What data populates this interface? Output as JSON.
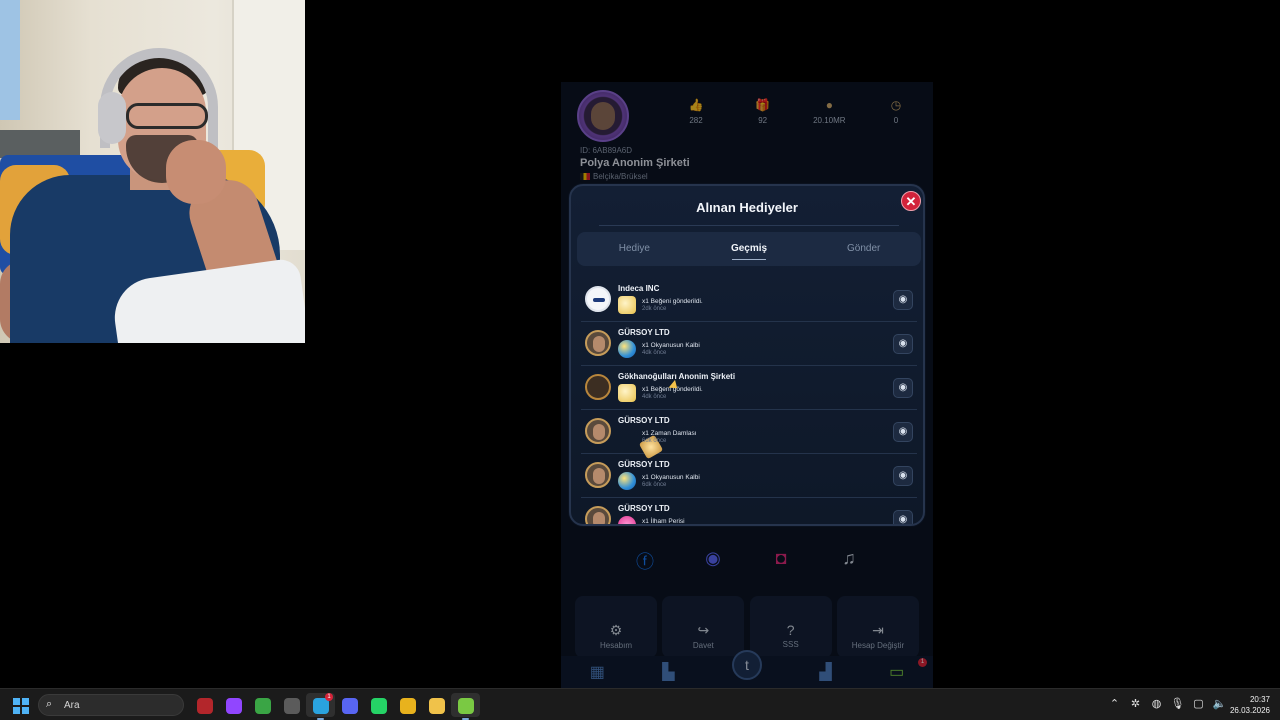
{
  "profile": {
    "stats": [
      {
        "icon": "thumbs-up-icon",
        "value": "282"
      },
      {
        "icon": "gift-icon",
        "value": "92"
      },
      {
        "icon": "coin-icon",
        "value": "20.10MR"
      },
      {
        "icon": "clock-icon",
        "value": "0"
      }
    ],
    "id": "ID: 6AB89A6D",
    "name": "Polya Anonim Şirketi",
    "location": "Belçika/Brüksel"
  },
  "modal": {
    "title": "Alınan Hediyeler",
    "close_label": "✕",
    "tabs": [
      {
        "label": "Hediye",
        "active": false
      },
      {
        "label": "Geçmiş",
        "active": true
      },
      {
        "label": "Gönder",
        "active": false
      }
    ],
    "entries": [
      {
        "name": "Indeca INC",
        "gift": "like",
        "desc": "x1 Beğeni gönderildi.",
        "time": "2dk önce",
        "avatar": "white"
      },
      {
        "name": "GÜRSOY LTD",
        "gift": "ocean",
        "desc": "x1 Okyanusun Kalbi",
        "time": "4dk önce",
        "avatar": "face"
      },
      {
        "name": "Gökhanoğulları Anonim Şirketi",
        "gift": "like",
        "desc": "x1 Beğeni gönderildi.",
        "time": "4dk önce",
        "avatar": "gold"
      },
      {
        "name": "GÜRSOY LTD",
        "gift": "time",
        "desc": "x1 Zaman Damlası",
        "time": "6dk önce",
        "avatar": "face"
      },
      {
        "name": "GÜRSOY LTD",
        "gift": "ocean",
        "desc": "x1 Okyanusun Kalbi",
        "time": "6dk önce",
        "avatar": "face"
      },
      {
        "name": "GÜRSOY LTD",
        "gift": "muse",
        "desc": "x1 İlham Perisi",
        "time": "6dk önce",
        "avatar": "face"
      }
    ]
  },
  "social": [
    "facebook-icon",
    "discord-icon",
    "instagram-icon",
    "headset-icon"
  ],
  "tiles": [
    {
      "icon": "user-gear-icon",
      "glyph": "⚙",
      "label": "Hesabım"
    },
    {
      "icon": "share-icon",
      "glyph": "↪",
      "label": "Davet"
    },
    {
      "icon": "question-icon",
      "glyph": "?",
      "label": "SSS"
    },
    {
      "icon": "switch-account-icon",
      "glyph": "⇥",
      "label": "Hesap Değiştir"
    }
  ],
  "nav": {
    "center_glyph": "t",
    "badge": "1"
  },
  "taskbar": {
    "search_placeholder": "Ara",
    "apps": [
      {
        "icon": "game-icon",
        "color": "#b3262b"
      },
      {
        "icon": "twitch-icon",
        "color": "#9146ff"
      },
      {
        "icon": "xbox-icon",
        "color": "#3aa545"
      },
      {
        "icon": "calculator-icon",
        "color": "#5b5b5b"
      },
      {
        "icon": "telegram-icon",
        "color": "#2aa3df",
        "active": true,
        "badge": "1"
      },
      {
        "icon": "discord-icon",
        "color": "#5865f2"
      },
      {
        "icon": "whatsapp-icon",
        "color": "#25d366"
      },
      {
        "icon": "chrome-icon",
        "color": "#e8b21d"
      },
      {
        "icon": "file-explorer-icon",
        "color": "#f0c24a"
      },
      {
        "icon": "bluestacks-icon",
        "color": "#7ac943",
        "active": true
      }
    ],
    "time": "20:37",
    "date": "26.03.2026"
  }
}
